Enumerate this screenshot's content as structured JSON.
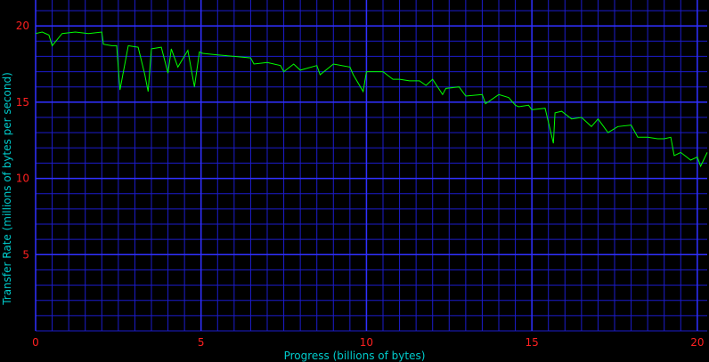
{
  "chart_data": {
    "type": "line",
    "title": "",
    "xlabel": "Progress (billions of bytes)",
    "ylabel": "Transfer Rate (millions of bytes per second)",
    "xlim": [
      0,
      20.3
    ],
    "ylim": [
      0,
      21.7
    ],
    "x_ticks": [
      0,
      5,
      10,
      15,
      20
    ],
    "y_ticks": [
      5,
      10,
      15,
      20
    ],
    "x_tick_labels": [
      "0",
      "5",
      "10",
      "15",
      "20"
    ],
    "y_tick_labels": [
      "5",
      "10",
      "15",
      "20"
    ],
    "grid": true,
    "legend": "none",
    "colors": {
      "background": "#000000",
      "grid": "#1c1ccc",
      "line": "#00ff00",
      "tick_labels": "#ff2020",
      "axis_labels": "#00cccc"
    },
    "series": [
      {
        "x": [
          0.0,
          0.2,
          0.4,
          0.5,
          0.8,
          1.2,
          1.6,
          2.0,
          2.05,
          2.3,
          2.45,
          2.5,
          2.55,
          2.8,
          3.1,
          3.3,
          3.4,
          3.5,
          3.8,
          4.0,
          4.1,
          4.3,
          4.6,
          4.8,
          4.95,
          5.05,
          5.5,
          6.0,
          6.5,
          6.6,
          7.0,
          7.4,
          7.5,
          7.8,
          8.0,
          8.5,
          8.6,
          9.0,
          9.5,
          9.6,
          9.9,
          10.0,
          10.5,
          10.8,
          11.0,
          11.3,
          11.6,
          11.8,
          12.0,
          12.3,
          12.4,
          12.8,
          13.0,
          13.5,
          13.6,
          14.0,
          14.3,
          14.5,
          14.6,
          14.9,
          15.0,
          15.4,
          15.65,
          15.7,
          15.9,
          16.2,
          16.5,
          16.8,
          17.0,
          17.3,
          17.6,
          18.0,
          18.2,
          18.5,
          18.8,
          19.0,
          19.2,
          19.3,
          19.5,
          19.8,
          20.0,
          20.1,
          20.3
        ],
        "values": [
          19.5,
          19.6,
          19.4,
          18.7,
          19.5,
          19.6,
          19.5,
          19.6,
          18.8,
          18.7,
          18.7,
          17.2,
          15.8,
          18.7,
          18.6,
          16.8,
          15.7,
          18.5,
          18.6,
          16.9,
          18.5,
          17.3,
          18.4,
          16.0,
          18.3,
          18.2,
          18.1,
          18.0,
          17.9,
          17.5,
          17.6,
          17.4,
          17.0,
          17.5,
          17.1,
          17.4,
          16.8,
          17.5,
          17.3,
          16.8,
          15.7,
          17.0,
          17.0,
          16.5,
          16.5,
          16.4,
          16.4,
          16.1,
          16.5,
          15.5,
          15.9,
          16.0,
          15.4,
          15.5,
          14.9,
          15.5,
          15.3,
          14.8,
          14.7,
          14.8,
          14.5,
          14.6,
          12.3,
          14.3,
          14.4,
          13.9,
          14.0,
          13.4,
          13.9,
          13.0,
          13.4,
          13.5,
          12.7,
          12.7,
          12.6,
          12.6,
          12.7,
          11.5,
          11.7,
          11.2,
          11.4,
          10.8,
          11.7
        ]
      }
    ]
  }
}
